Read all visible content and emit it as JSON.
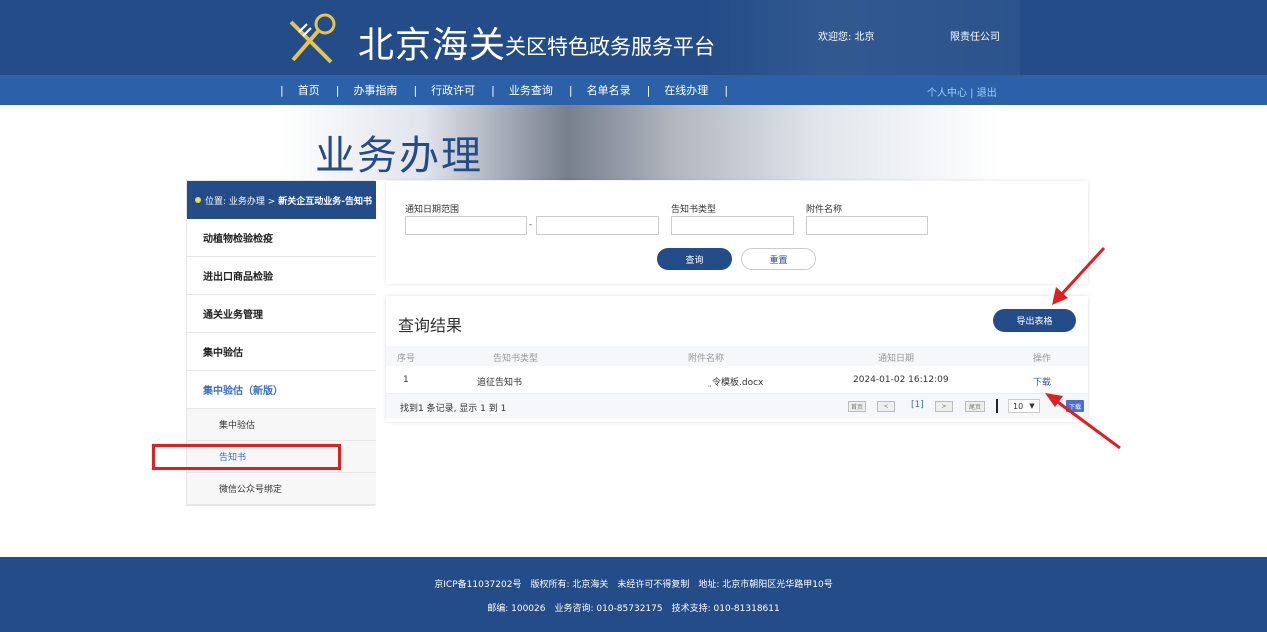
{
  "header": {
    "site_title": "北京海关",
    "site_subtitle": "关区特色政务服务平台",
    "welcome": "欢迎您: 北京",
    "company": "限责任公司"
  },
  "nav": {
    "items": [
      "首页",
      "办事指南",
      "行政许可",
      "业务查询",
      "名单名录",
      "在线办理"
    ],
    "user_links": "个人中心 | 退出"
  },
  "banner": {
    "title": "业务办理"
  },
  "breadcrumb": {
    "prefix": "位置:",
    "path": "业务办理 >",
    "current": "新关企互动业务-告知书"
  },
  "sidebar": {
    "items": [
      "动植物检验检疫",
      "进出口商品检验",
      "通关业务管理",
      "集中验估",
      "集中验估（新版）"
    ],
    "subitems": [
      "集中验估",
      "告知书",
      "微信公众号绑定"
    ]
  },
  "filters": {
    "date_range_label": "通知日期范围",
    "date_sep": "-",
    "type_label": "告知书类型",
    "attachment_label": "附件名称",
    "query_button": "查询",
    "reset_button": "重置"
  },
  "results": {
    "title": "查询结果",
    "export_button": "导出表格",
    "columns": [
      "序号",
      "告知书类型",
      "附件名称",
      "通知日期",
      "操作"
    ],
    "rows": [
      {
        "index": "1",
        "type": "追征告知书",
        "attachment": "̤令模板.docx",
        "date": "2024-01-02 16:12:09",
        "action": "下载"
      }
    ],
    "summary": "找到1 条记录, 显示 1 到 1",
    "pager": {
      "first": "首页",
      "prev": "<",
      "current": "[1]",
      "next": ">",
      "last": "尾页",
      "page_size": "10",
      "download": "下载"
    }
  },
  "footer": {
    "line1": "京ICP备11037202号　版权所有: 北京海关　未经许可不得复制　地址: 北京市朝阳区光华路甲10号",
    "line2": "邮编: 100026　业务咨询: 010-85732175　技术支持: 010-81318611"
  },
  "colors": {
    "brand": "#234c88",
    "nav": "#2a61a8",
    "annotation": "#e02020"
  }
}
